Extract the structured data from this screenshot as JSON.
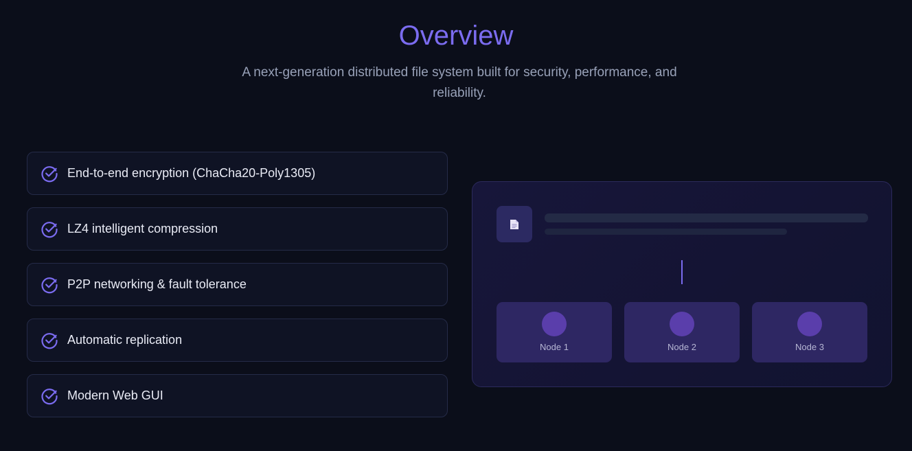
{
  "header": {
    "title": "Overview",
    "subtitle": "A next-generation distributed file system built for security, performance, and reliability."
  },
  "features": [
    {
      "label": "End-to-end encryption (ChaCha20-Poly1305)",
      "icon": "check-circle-icon"
    },
    {
      "label": "LZ4 intelligent compression",
      "icon": "check-circle-icon"
    },
    {
      "label": "P2P networking & fault tolerance",
      "icon": "check-circle-icon"
    },
    {
      "label": "Automatic replication",
      "icon": "check-circle-icon"
    },
    {
      "label": "Modern Web GUI",
      "icon": "check-circle-icon"
    }
  ],
  "diagram": {
    "file_icon": "document-icon",
    "nodes": [
      {
        "label": "Node 1"
      },
      {
        "label": "Node 2"
      },
      {
        "label": "Node 3"
      }
    ]
  },
  "colors": {
    "accent": "#7b6cf0",
    "background": "#0b0e1a",
    "node": "#2e2763",
    "node_dot": "#5a3eab"
  }
}
